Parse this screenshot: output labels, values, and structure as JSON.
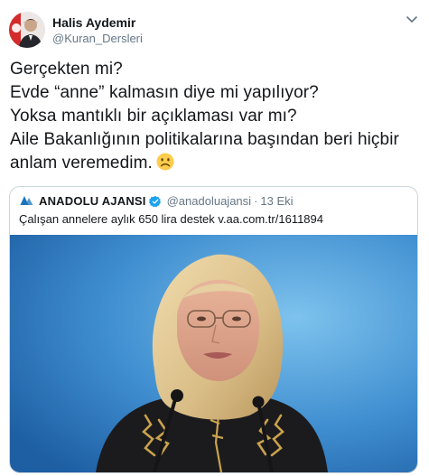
{
  "user": {
    "display_name": "Halis Aydemir",
    "handle": "@Kuran_Dersleri"
  },
  "tweet": {
    "lines": [
      "Gerçekten mi?",
      "Evde “anne” kalmasın diye mi yapılıyor?",
      "Yoksa mantıklı bir açıklaması var mı?",
      "Aile Bakanlığının politikalarına başından beri hiçbir",
      "anlam veremedim."
    ],
    "emoji": "slightly-frowning-face"
  },
  "quote": {
    "name": "ANADOLU AJANSI",
    "handle": "@anadoluajansi",
    "separator": "·",
    "date": "13 Eki",
    "text": "Çalışan annelere aylık 650 lira destek v.aa.com.tr/1611894",
    "logo_icon": "anadolu-ajansi-logo",
    "verified_icon": "verified-badge-icon",
    "media": "photo-woman-speaking-at-microphones"
  },
  "colors": {
    "text": "#14171a",
    "secondary": "#657786",
    "border": "#ccd6dd",
    "verified": "#1da1f2",
    "aa_blue": "#1b75bb"
  }
}
